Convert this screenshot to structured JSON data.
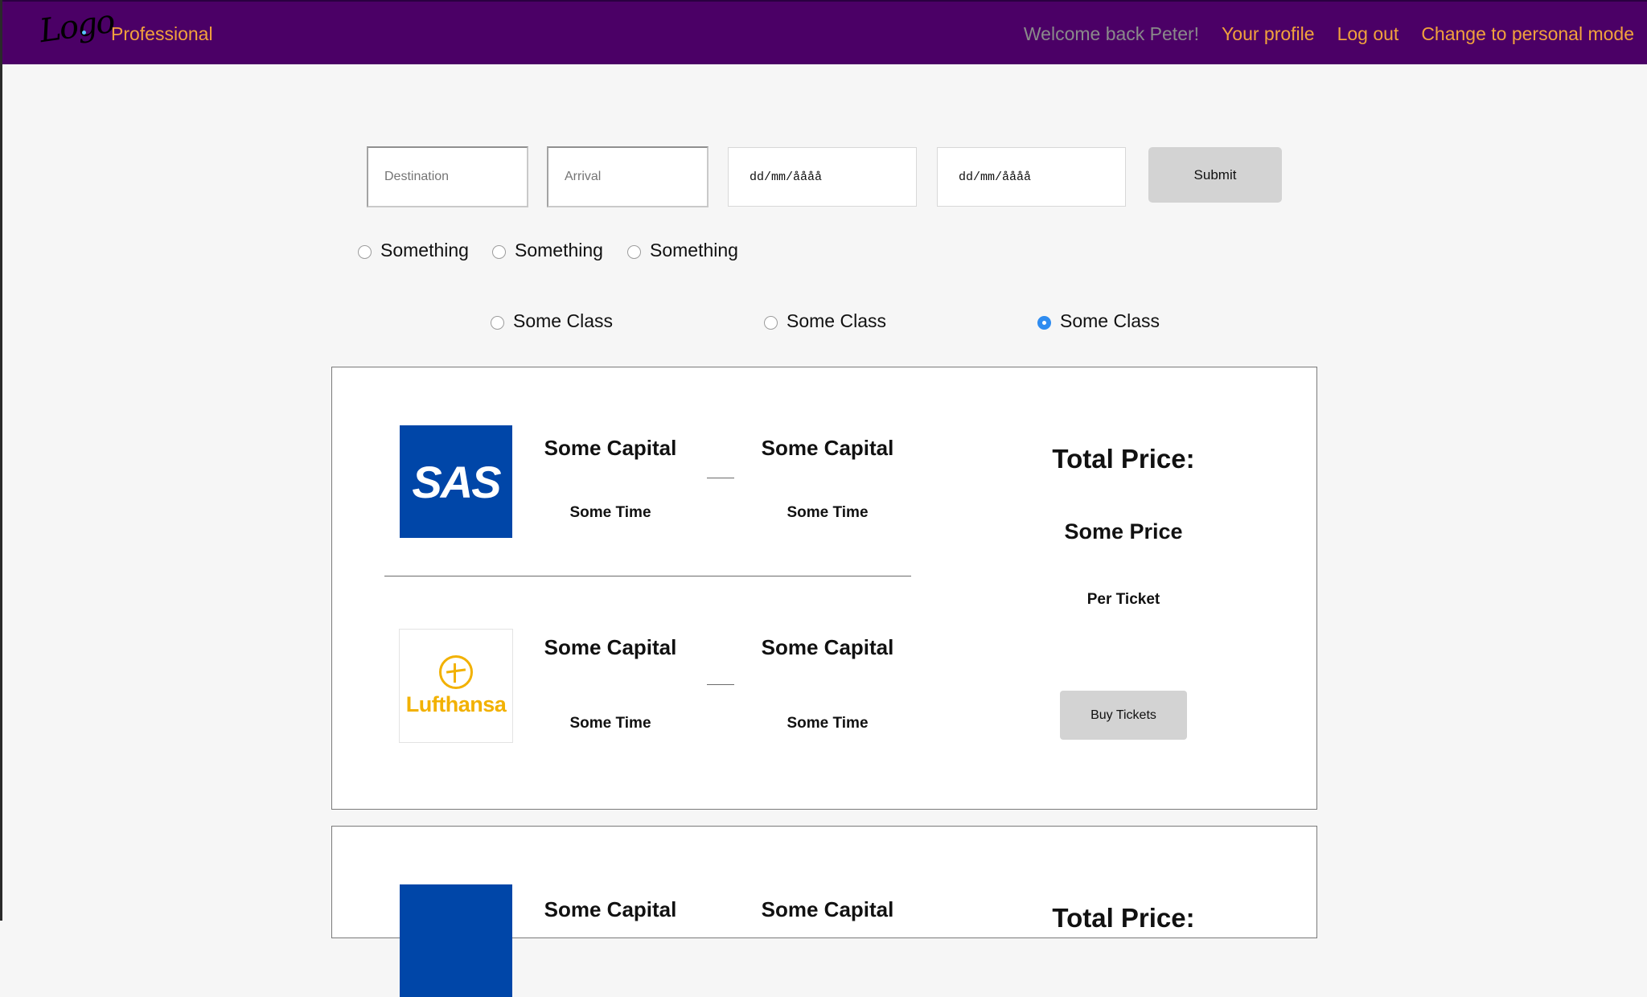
{
  "nav": {
    "logo_text": "Logo",
    "mode_label": "Professional",
    "welcome": "Welcome back Peter!",
    "profile": "Your profile",
    "logout": "Log out",
    "change_mode": "Change to personal mode"
  },
  "search": {
    "destination_placeholder": "Destination",
    "arrival_placeholder": "Arrival",
    "date1": "dd/mm/åååå",
    "date2": "dd/mm/åååå",
    "submit": "Submit"
  },
  "options": [
    "Something",
    "Something",
    "Something"
  ],
  "classes": [
    {
      "label": "Some Class",
      "checked": false
    },
    {
      "label": "Some Class",
      "checked": false
    },
    {
      "label": "Some Class",
      "checked": true
    }
  ],
  "results": [
    {
      "flights": [
        {
          "airline": "SAS",
          "from_city": "Some Capital",
          "to_city": "Some Capital",
          "from_time": "Some Time",
          "to_time": "Some Time"
        },
        {
          "airline": "Lufthansa",
          "from_city": "Some Capital",
          "to_city": "Some Capital",
          "from_time": "Some Time",
          "to_time": "Some Time"
        }
      ],
      "total_label": "Total Price:",
      "price": "Some Price",
      "per_ticket": "Per Ticket",
      "buy": "Buy Tickets"
    },
    {
      "flights": [
        {
          "from_city": "Some Capital",
          "to_city": "Some Capital"
        }
      ],
      "total_label": "Total Price:"
    }
  ],
  "colors": {
    "nav_bg": "#4b0066",
    "accent": "#f2a23c",
    "sas_blue": "#0046a8",
    "lufthansa_yellow": "#f2b100",
    "radio_checked": "#2f8cf0"
  }
}
